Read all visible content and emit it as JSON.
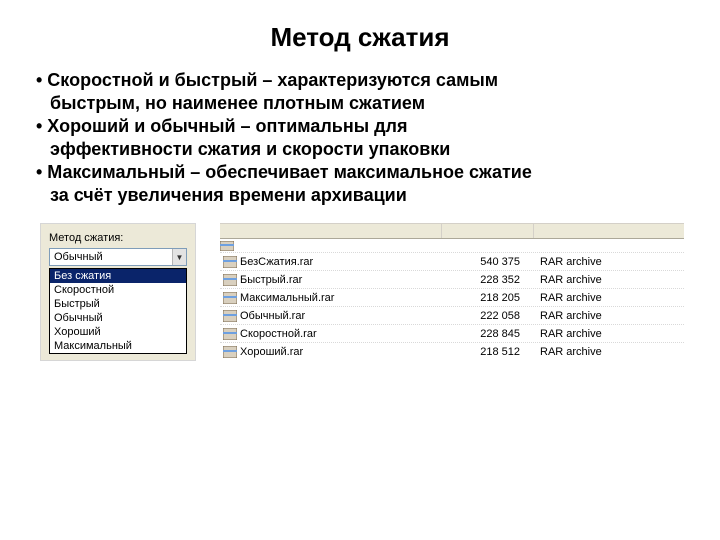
{
  "title": "Метод сжатия",
  "bullets": {
    "b1a": "• Скоростной и быстрый – характеризуются самым",
    "b1b": "быстрым, но наименее плотным сжатием",
    "b2a": "• Хороший и обычный – оптимальны для",
    "b2b": "эффективности сжатия и скорости упаковки",
    "b3a": "• Максимальный – обеспечивает максимальное сжатие",
    "b3b": "за счёт увеличения времени архивации"
  },
  "dropdown": {
    "label": "Метод сжатия:",
    "selected": "Обычный",
    "opt0": "Без сжатия",
    "opt1": "Скоростной",
    "opt2": "Быстрый",
    "opt3": "Обычный",
    "opt4": "Хороший",
    "opt5": "Максимальный"
  },
  "files": {
    "r0": {
      "name": "БезСжатия.rar",
      "size": "540 375",
      "type": "RAR archive"
    },
    "r1": {
      "name": "Быстрый.rar",
      "size": "228 352",
      "type": "RAR archive"
    },
    "r2": {
      "name": "Максимальный.rar",
      "size": "218 205",
      "type": "RAR archive"
    },
    "r3": {
      "name": "Обычный.rar",
      "size": "222 058",
      "type": "RAR archive"
    },
    "r4": {
      "name": "Скоростной.rar",
      "size": "228 845",
      "type": "RAR archive"
    },
    "r5": {
      "name": "Хороший.rar",
      "size": "218 512",
      "type": "RAR archive"
    }
  }
}
